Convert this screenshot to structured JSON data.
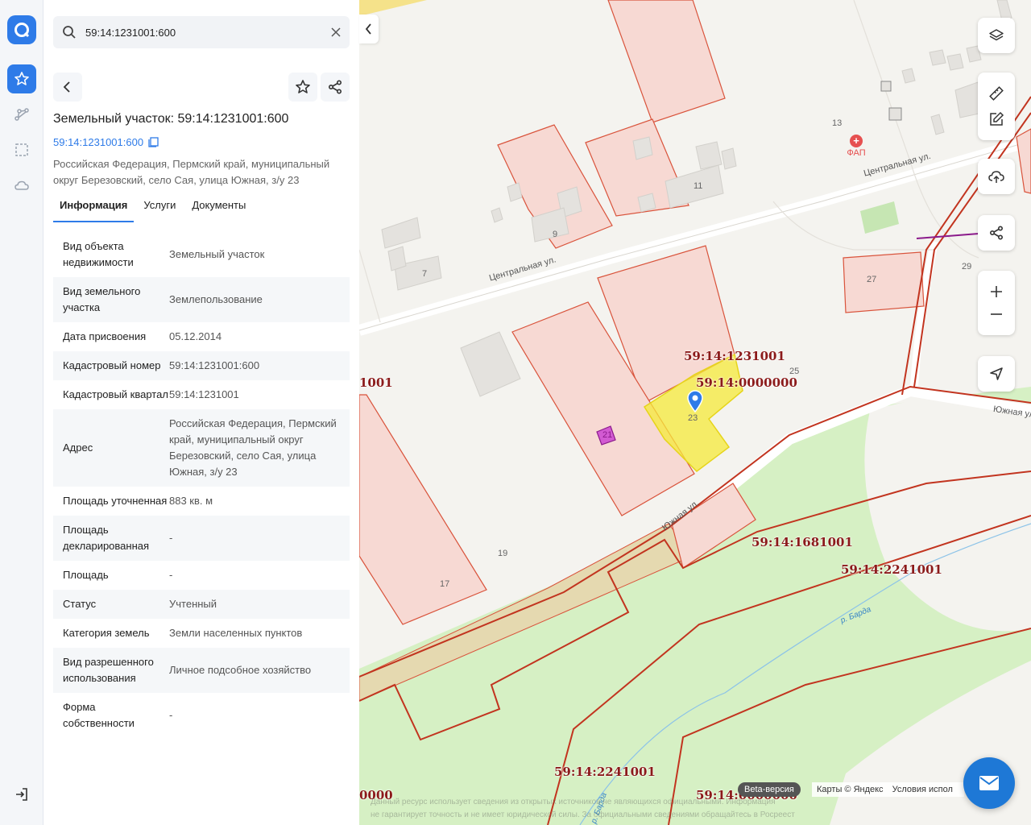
{
  "search": {
    "value": "59:14:1231001:600"
  },
  "panel": {
    "title": "Земельный участок: 59:14:1231001:600",
    "cad_link": "59:14:1231001:600",
    "address": "Российская Федерация, Пермский край, муниципальный округ Березовский, село Сая, улица Южная, з/у 23",
    "tabs": [
      "Информация",
      "Услуги",
      "Документы"
    ],
    "rows": [
      {
        "k": "Вид объекта недвижимости",
        "v": "Земельный участок"
      },
      {
        "k": "Вид земельного участка",
        "v": "Землепользование"
      },
      {
        "k": "Дата присвоения",
        "v": "05.12.2014"
      },
      {
        "k": "Кадастровый номер",
        "v": "59:14:1231001:600"
      },
      {
        "k": "Кадастровый квартал",
        "v": "59:14:1231001"
      },
      {
        "k": "Адрес",
        "v": "Российская Федерация, Пермский край, муниципальный округ Березовский, село Сая, улица Южная, з/у 23"
      },
      {
        "k": "Площадь уточненная",
        "v": "883 кв. м"
      },
      {
        "k": "Площадь декларированная",
        "v": "-"
      },
      {
        "k": "Площадь",
        "v": "-"
      },
      {
        "k": "Статус",
        "v": "Учтенный"
      },
      {
        "k": "Категория земель",
        "v": "Земли населенных пунктов"
      },
      {
        "k": "Вид разрешенного использования",
        "v": "Личное подсобное хозяйство"
      },
      {
        "k": "Форма собственности",
        "v": "-"
      }
    ]
  },
  "map": {
    "streets": {
      "central_1": "Центральная ул.",
      "central_2": "Центральная ул.",
      "south": "Южная ул.",
      "south_2": "Южная ул",
      "river": "р. Барда",
      "river_2": "р. Барда"
    },
    "house_numbers": [
      "13",
      "11",
      "9",
      "7",
      "27",
      "29",
      "25",
      "23",
      "21",
      "19",
      "17"
    ],
    "poi": "ФАП",
    "cad_labels": [
      "59:14:1231001",
      "59:14:0000000",
      "59:14:1681001",
      "59:14:2241001",
      "59:14:2241001",
      "59:14:0000000",
      "1001",
      "0000"
    ],
    "beta": "Beta-версия",
    "attribution": "Карты © Яндекс",
    "terms": "Условия испол",
    "disclaimer_1": "Данный ресурс использует сведения из открытых источников не являющихся официальными. Информация",
    "disclaimer_2": "не гарантирует точность и не имеет юридической силы. За официальными сведениями обращайтесь в Росреест"
  },
  "colors": {
    "accent": "#2e7be8",
    "parcel_fill": "#f7d9d3",
    "parcel_stroke": "#d9533b",
    "selected": "#f5ea3a",
    "cad_label": "#8b1a1a",
    "green": "#d6f0c4"
  }
}
